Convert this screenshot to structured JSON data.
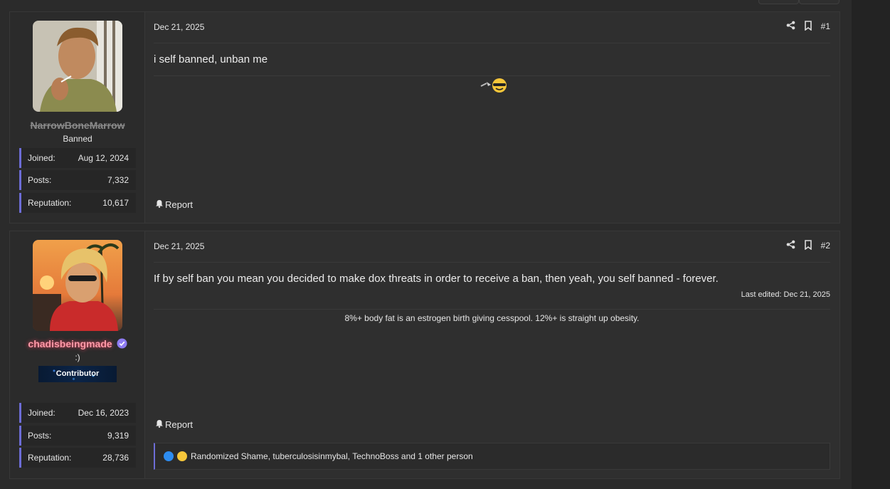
{
  "posts": [
    {
      "date": "Dec 21, 2025",
      "number": "#1",
      "username": "NarrowBoneMarrow",
      "user_title": "Banned",
      "stats": [
        {
          "label": "Joined:",
          "value": "Aug 12, 2024"
        },
        {
          "label": "Posts:",
          "value": "7,332"
        },
        {
          "label": "Reputation:",
          "value": "10,617"
        }
      ],
      "body": "i self banned, unban me",
      "report_label": "Report"
    },
    {
      "date": "Dec 21, 2025",
      "number": "#2",
      "username": "chadisbeingmade",
      "user_title": ":)",
      "badge": "Contributor",
      "stats": [
        {
          "label": "Joined:",
          "value": "Dec 16, 2023"
        },
        {
          "label": "Posts:",
          "value": "9,319"
        },
        {
          "label": "Reputation:",
          "value": "28,736"
        }
      ],
      "body": "If by self ban you mean you decided to make dox threats in order to receive a ban, then yeah, you self banned - forever.",
      "last_edited": "Last edited: Dec 21, 2025",
      "signature": "8%+ body fat is an estrogen birth giving cesspool. 12%+ is straight up obesity.",
      "report_label": "Report",
      "reactions_text": "Randomized Shame, tuberculosisinmybal, TechnoBoss and 1 other person"
    }
  ],
  "colors": {
    "accent": "#6d6dd6",
    "banned_name": "#8a8a8a",
    "contributor_name": "#ff9aa8",
    "verified": "#8e7cf2"
  },
  "icons": [
    "share-icon",
    "bookmark-icon",
    "bell-icon",
    "verified-icon",
    "like-icon",
    "laugh-icon"
  ]
}
